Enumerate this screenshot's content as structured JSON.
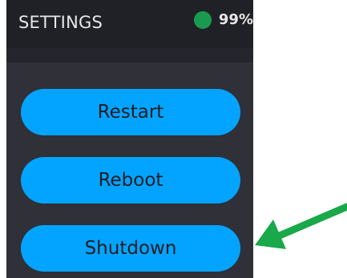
{
  "header": {
    "title": "SETTINGS",
    "battery_label": "99%",
    "battery_status_color": "#1a9a4f"
  },
  "buttons": [
    {
      "label": "Restart"
    },
    {
      "label": "Reboot"
    },
    {
      "label": "Shutdown"
    }
  ],
  "colors": {
    "button_fill": "#03a4ff",
    "panel_background": "#2f3038",
    "header_background": "#202127",
    "annotation_arrow": "#19a84a"
  },
  "annotation": {
    "icon": "green-arrow-icon"
  }
}
